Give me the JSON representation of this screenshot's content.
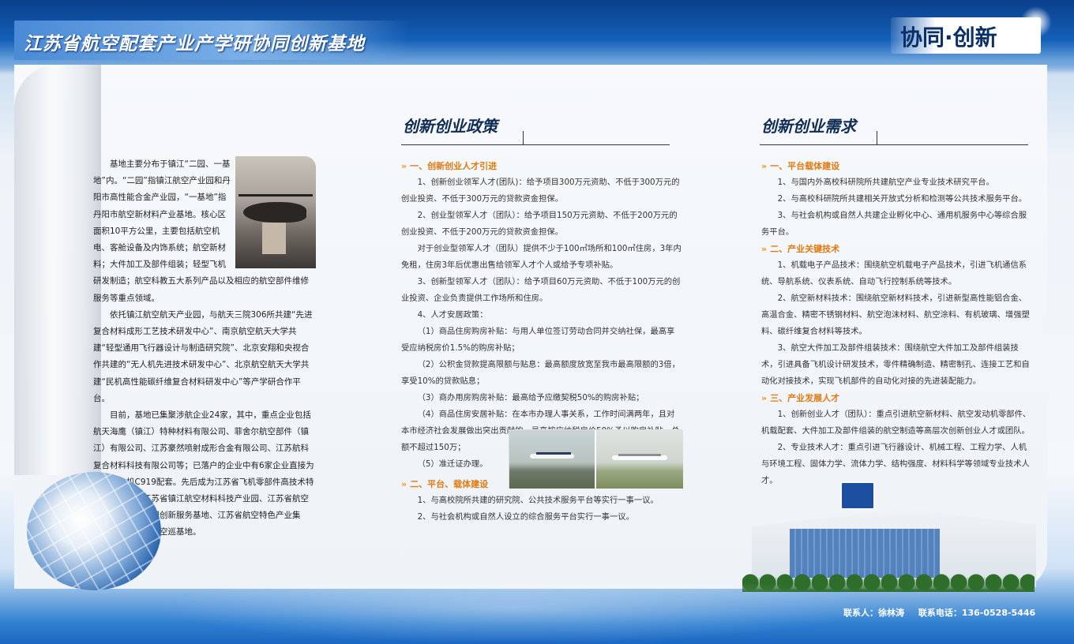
{
  "header": {
    "title": "江苏省航空配套产业产学研协同创新基地",
    "slogan": "协同·创新"
  },
  "intro": {
    "paragraphs": [
      "基地主要分布于镇江“二园、一基地”内。“二园”指镇江航空产业园和丹阳市高性能合金产业园，“一基地”指丹阳市航空新材料产业基地。核心区面积10平方公里，主要包括航空机电、客舱设备及内饰系统；航空新材料；大件加工及部件组装；轻型飞机研发制造；航空科教五大系列产品以及相应的航空部件维修服务等重点领域。",
      "依托镇江航空航天产业园，与航天三院306所共建“先进复合材料成形工艺技术研发中心”、南京航空航天大学共建“轻型通用飞行器设计与制造研究院”、北京安翔和央视合作共建的“无人机先进技术研发中心”、北京航空航天大学共建“民机高性能碳纤维复合材料研发中心”等产学研合作平台。",
      "目前，基地已集聚涉航企业24家，其中，重点企业包括航天海鹰（镇江）特种材料有限公司、菲舍尔航空部件（镇江）有限公司、江苏豪然喷射成形合金有限公司、江苏航科复合材料科技有限公司等；已落户的企业中有6家企业直接为国产大飞机C919配套。先后成为江苏省飞机零部件高技术特色产业基地、江苏省镇江航空材料科技产业园、江苏省航空产业军民结合协同创新服务基地、江苏省航空特色产业集群、江苏省海事局空巡基地。"
    ]
  },
  "policy": {
    "heading": "创新创业政策",
    "sections": [
      {
        "title": "一、创新创业人才引进",
        "items": [
          "1、创新创业领军人才(团队)：给予项目300万元资助、不低于300万元的创业投资、不低于300万元的贷款资金担保。",
          "2、创业型领军人才（团队）：给予项目150万元资助、不低于200万元的创业投资、不低于200万元的贷款资金担保。",
          "对于创业型领军人才（团队）提供不少于100㎡场所和100㎡住房，3年内免租，住房3年后优惠出售给领军人才个人或给予专项补贴。",
          "3、创新型领军人才（团队）：给予项目60万元资助、不低于100万元的创业投资、企业负责提供工作场所和住房。",
          "4、人才安居政策：",
          "（1）商品住房购房补贴：与用人单位签订劳动合同并交纳社保，最高享受应纳税房价1.5%的购房补贴；",
          "（2）公积金贷款提高限额与贴息：最高额度放宽至我市最高限额的3倍，享受10%的贷款贴息；",
          "（3）商办用房购房补贴：最高给予应缴契税50%的购房补贴；",
          "（4）商品住房安居补贴：在本市办理人事关系，工作时间满两年，且对本市经济社会发展做出突出贡献的，最高按应纳税房价50%予以购房补贴，总额不超过150万；",
          "（5）准迁证办理。"
        ]
      },
      {
        "title": "二、平台、载体建设",
        "items": [
          "1、与高校院所共建的研究院、公共技术服务平台等实行一事一议。",
          "2、与社会机构或自然人设立的综合服务平台实行一事一议。"
        ]
      }
    ]
  },
  "demand": {
    "heading": "创新创业需求",
    "sections": [
      {
        "title": "一、平台载体建设",
        "items": [
          "1、与国内外高校科研院所共建航空产业专业技术研究平台。",
          "2、与高校科研院所共建相关开放式分析和检测等公共技术服务平台。",
          "3、与社会机构或自然人共建企业孵化中心、通用机服务中心等综合服务平台。"
        ]
      },
      {
        "title": "二、产业关键技术",
        "items": [
          "1、机载电子产品技术：围绕航空机载电子产品技术，引进飞机通信系统、导航系统、仪表系统、自动飞行控制系统等技术。",
          "2、航空新材料技术：围绕航空新材料技术，引进新型高性能铝合金、高温合金、精密不锈钢材料、航空泡沫材料、航空涂料、有机玻璃、增强塑料、碳纤维复合材料等技术。",
          "3、航空大件加工及部件组装技术：围绕航空大件加工及部件组装技术，引进具备飞机设计研发技术，零件精确制造、精密制孔、连接工艺和自动化对接技术，实现飞机部件的自动化对接的先进装配能力。"
        ]
      },
      {
        "title": "三、产业发展人才",
        "items": [
          "1、创新创业人才（团队）：重点引进航空新材料、航空发动机零部件、机载配套、大件加工及部件组装的航空制造等高层次创新创业人才或团队。",
          "2、专业技术人才：重点引进飞行器设计、机械工程、工程力学、人机与环境工程、固体力学、流体力学、结构强度、材料科学等领域专业技术人才。"
        ]
      }
    ]
  },
  "contact": {
    "person": "联系人：徐林涛",
    "phone": "联系电话：136-0528-5446"
  },
  "colors": {
    "accent": "#e07a10",
    "heading": "#0f2c52",
    "brand_blue": "#1460b8"
  }
}
